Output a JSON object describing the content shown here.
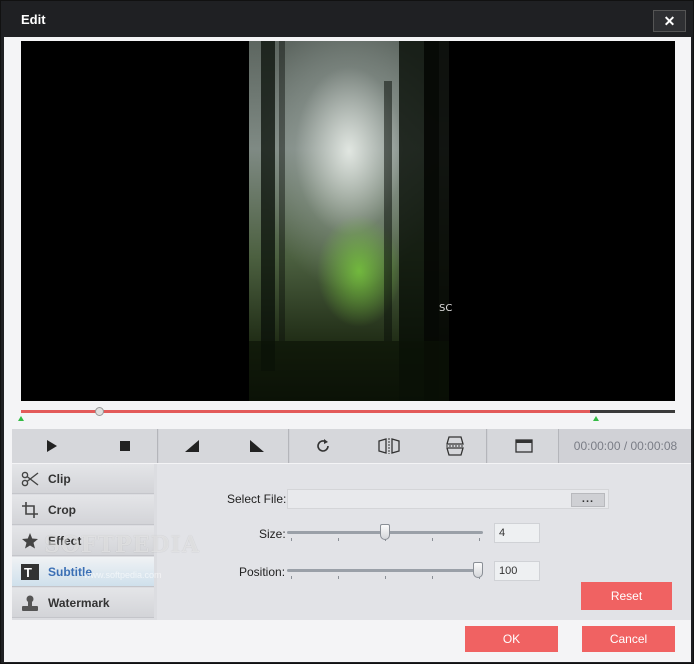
{
  "window": {
    "title": "Edit",
    "close_symbol": "✕"
  },
  "preview": {
    "overlay_text": "SC"
  },
  "timeline": {
    "playhead_fraction": 0.12,
    "clip_end_fraction": 0.87
  },
  "toolbar": {
    "buttons": [
      "play-icon",
      "stop-icon",
      "rotate-left-icon",
      "rotate-right-icon",
      "rotate-icon",
      "flip-horizontal-icon",
      "flip-vertical-icon",
      "window-icon"
    ],
    "time": "00:00:00 / 00:00:08"
  },
  "sidebar": {
    "items": [
      {
        "label": "Clip",
        "icon": "scissors-icon"
      },
      {
        "label": "Crop",
        "icon": "crop-icon"
      },
      {
        "label": "Effect",
        "icon": "star-icon"
      },
      {
        "label": "Subtitle",
        "icon": "subtitle-icon",
        "active": true
      },
      {
        "label": "Watermark",
        "icon": "stamp-icon"
      }
    ]
  },
  "subtitle": {
    "select_file_label": "Select File:",
    "file_value": "",
    "browse_label": "...",
    "size_label": "Size:",
    "size_value": "4",
    "position_label": "Position:",
    "position_value": "100",
    "reset_label": "Reset"
  },
  "footer": {
    "ok_label": "OK",
    "cancel_label": "Cancel"
  },
  "watermark": {
    "text": "SOFTPEDIA",
    "sub": "www.softpedia.com"
  },
  "colors": {
    "accent_red": "#f06262",
    "titlebar": "#1f2023",
    "active_blue": "#3a6fb5"
  }
}
